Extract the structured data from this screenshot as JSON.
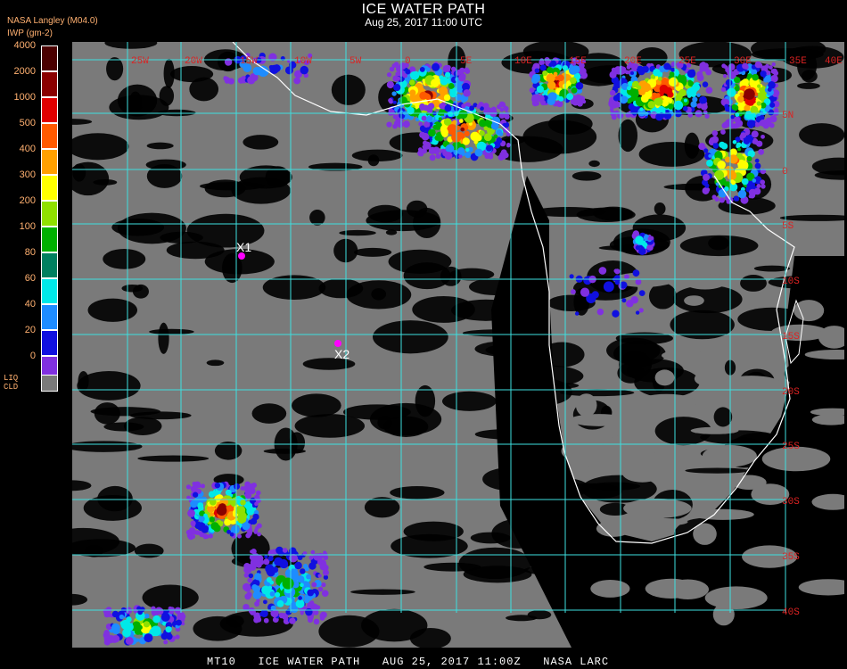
{
  "title": "ICE WATER PATH",
  "subtitle": "Aug 25, 2017 11:00 UTC",
  "source": "NASA Langley (M04.0)",
  "unit_label": "IWP (gm-2)",
  "colorbar": {
    "labels": [
      "4000",
      "2000",
      "1000",
      "500",
      "400",
      "300",
      "200",
      "100",
      "80",
      "60",
      "40",
      "20",
      "0"
    ],
    "colors": [
      "#4a0000",
      "#8a0000",
      "#e00000",
      "#ff5a00",
      "#ffa000",
      "#ffff00",
      "#90e000",
      "#00b000",
      "#008060",
      "#00e8e8",
      "#1e8cff",
      "#1010e0",
      "#8030e0"
    ],
    "liq_label": "LIQ\nCLD",
    "liq_color": "#7a7a7a"
  },
  "grid": {
    "lon_labels": [
      "25W",
      "20W",
      "15W",
      "10W",
      "5W",
      "0",
      "5E",
      "10E",
      "15E",
      "20E",
      "25E",
      "30E",
      "35E",
      "40E"
    ],
    "lat_labels": [
      "5N",
      "0",
      "5S",
      "10S",
      "15S",
      "20S",
      "25S",
      "30S",
      "35S",
      "40S"
    ]
  },
  "markers": [
    {
      "label": "X1",
      "color": "#ff00ff"
    },
    {
      "label": "X2",
      "color": "#ff00ff"
    }
  ],
  "footer": "MT10   ICE WATER PATH   AUG 25, 2017 11:00Z   NASA LARC"
}
